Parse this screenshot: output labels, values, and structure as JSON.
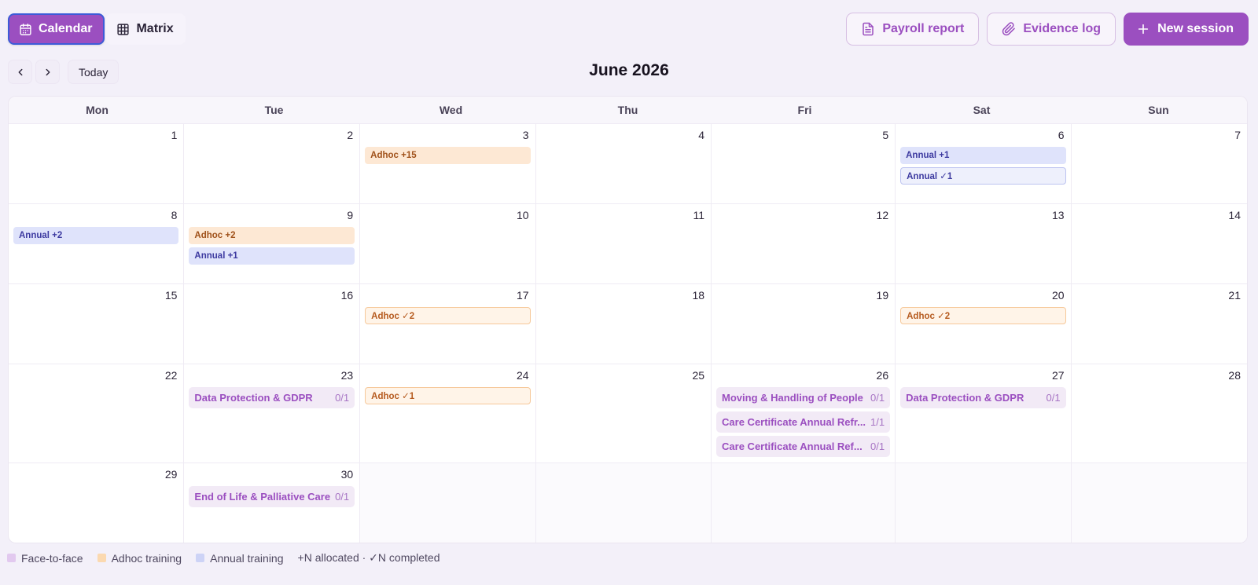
{
  "view_toggle": {
    "calendar_label": "Calendar",
    "matrix_label": "Matrix"
  },
  "actions": {
    "payroll_label": "Payroll report",
    "evidence_label": "Evidence log",
    "new_session_label": "New session"
  },
  "nav": {
    "today_label": "Today",
    "month_title": "June 2026"
  },
  "weekdays": [
    "Mon",
    "Tue",
    "Wed",
    "Thu",
    "Fri",
    "Sat",
    "Sun"
  ],
  "days": [
    {
      "num": "1",
      "events": []
    },
    {
      "num": "2",
      "events": []
    },
    {
      "num": "3",
      "events": [
        {
          "kind": "adhoc",
          "label": "Adhoc +15"
        }
      ]
    },
    {
      "num": "4",
      "events": []
    },
    {
      "num": "5",
      "events": []
    },
    {
      "num": "6",
      "events": [
        {
          "kind": "annual",
          "label": "Annual +1"
        },
        {
          "kind": "annual-done",
          "label": "Annual ✓1"
        }
      ]
    },
    {
      "num": "7",
      "events": []
    },
    {
      "num": "8",
      "events": [
        {
          "kind": "annual",
          "label": "Annual +2"
        }
      ]
    },
    {
      "num": "9",
      "events": [
        {
          "kind": "adhoc",
          "label": "Adhoc +2"
        },
        {
          "kind": "annual",
          "label": "Annual +1"
        }
      ]
    },
    {
      "num": "10",
      "events": []
    },
    {
      "num": "11",
      "events": []
    },
    {
      "num": "12",
      "events": []
    },
    {
      "num": "13",
      "events": []
    },
    {
      "num": "14",
      "events": []
    },
    {
      "num": "15",
      "events": []
    },
    {
      "num": "16",
      "events": []
    },
    {
      "num": "17",
      "events": [
        {
          "kind": "adhoc-done",
          "label": "Adhoc ✓2"
        }
      ]
    },
    {
      "num": "18",
      "events": []
    },
    {
      "num": "19",
      "events": []
    },
    {
      "num": "20",
      "events": [
        {
          "kind": "adhoc-done",
          "label": "Adhoc ✓2"
        }
      ]
    },
    {
      "num": "21",
      "events": []
    },
    {
      "num": "22",
      "events": []
    },
    {
      "num": "23",
      "events": [
        {
          "kind": "f2f",
          "label": "Data Protection & GDPR",
          "count": "0/1"
        }
      ]
    },
    {
      "num": "24",
      "events": [
        {
          "kind": "adhoc-done",
          "label": "Adhoc ✓1"
        }
      ]
    },
    {
      "num": "25",
      "events": []
    },
    {
      "num": "26",
      "events": [
        {
          "kind": "f2f",
          "label": "Moving & Handling of People",
          "count": "0/1"
        },
        {
          "kind": "f2f",
          "label": "Care Certificate Annual Refr...",
          "count": "1/1"
        },
        {
          "kind": "f2f",
          "label": "Care Certificate Annual Ref...",
          "count": "0/1"
        }
      ]
    },
    {
      "num": "27",
      "events": [
        {
          "kind": "f2f",
          "label": "Data Protection & GDPR",
          "count": "0/1"
        }
      ]
    },
    {
      "num": "28",
      "events": []
    },
    {
      "num": "29",
      "events": []
    },
    {
      "num": "30",
      "events": [
        {
          "kind": "f2f",
          "label": "End of Life & Palliative Care",
          "count": "0/1"
        }
      ]
    },
    {
      "num": "",
      "events": []
    },
    {
      "num": "",
      "events": []
    },
    {
      "num": "",
      "events": []
    },
    {
      "num": "",
      "events": []
    },
    {
      "num": "",
      "events": []
    }
  ],
  "legend": {
    "items": [
      {
        "label": "Face-to-face",
        "color": "#e2c9ef"
      },
      {
        "label": "Adhoc training",
        "color": "#fbd9b0"
      },
      {
        "label": "Annual training",
        "color": "#cdd3f6"
      }
    ],
    "note": "+N allocated · ✓N completed"
  },
  "colors": {
    "accent": "#9b4fc0",
    "adhoc_text": "#a0511a",
    "annual_text": "#3d3aa0"
  }
}
